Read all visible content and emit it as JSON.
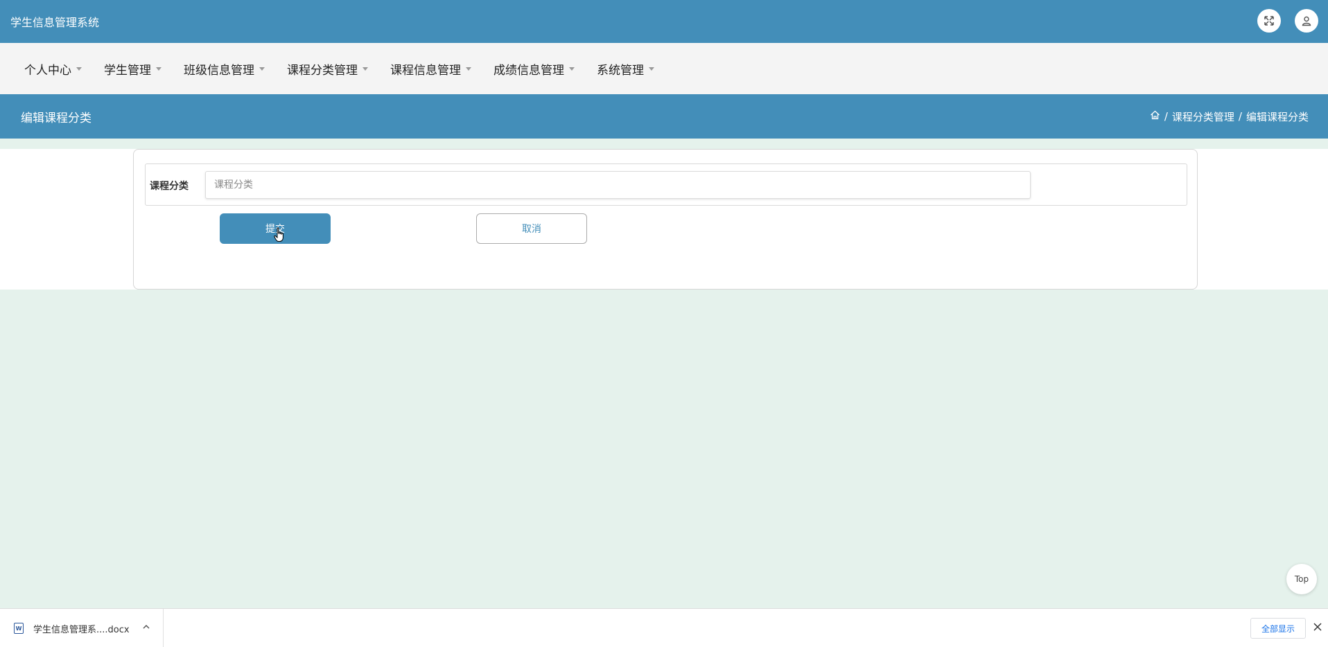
{
  "app": {
    "title": "学生信息管理系统"
  },
  "header_icons": [
    "fullscreen-icon",
    "user-icon"
  ],
  "nav": {
    "items": [
      {
        "label": "个人中心"
      },
      {
        "label": "学生管理"
      },
      {
        "label": "班级信息管理"
      },
      {
        "label": "课程分类管理"
      },
      {
        "label": "课程信息管理"
      },
      {
        "label": "成绩信息管理"
      },
      {
        "label": "系统管理"
      }
    ]
  },
  "page": {
    "title": "编辑课程分类",
    "breadcrumb": {
      "sep": "/",
      "items": [
        "课程分类管理",
        "编辑课程分类"
      ]
    }
  },
  "form": {
    "field_label": "课程分类",
    "field_value": "",
    "field_placeholder": "课程分类",
    "submit_label": "提交",
    "cancel_label": "取消"
  },
  "scroll_top": {
    "label": "Top"
  },
  "download_bar": {
    "file_name": "学生信息管理系....docx",
    "show_all_label": "全部显示"
  },
  "colors": {
    "primary": "#438eb9",
    "background": "#e5f2ec",
    "nav_bg": "#f4f4f4"
  }
}
